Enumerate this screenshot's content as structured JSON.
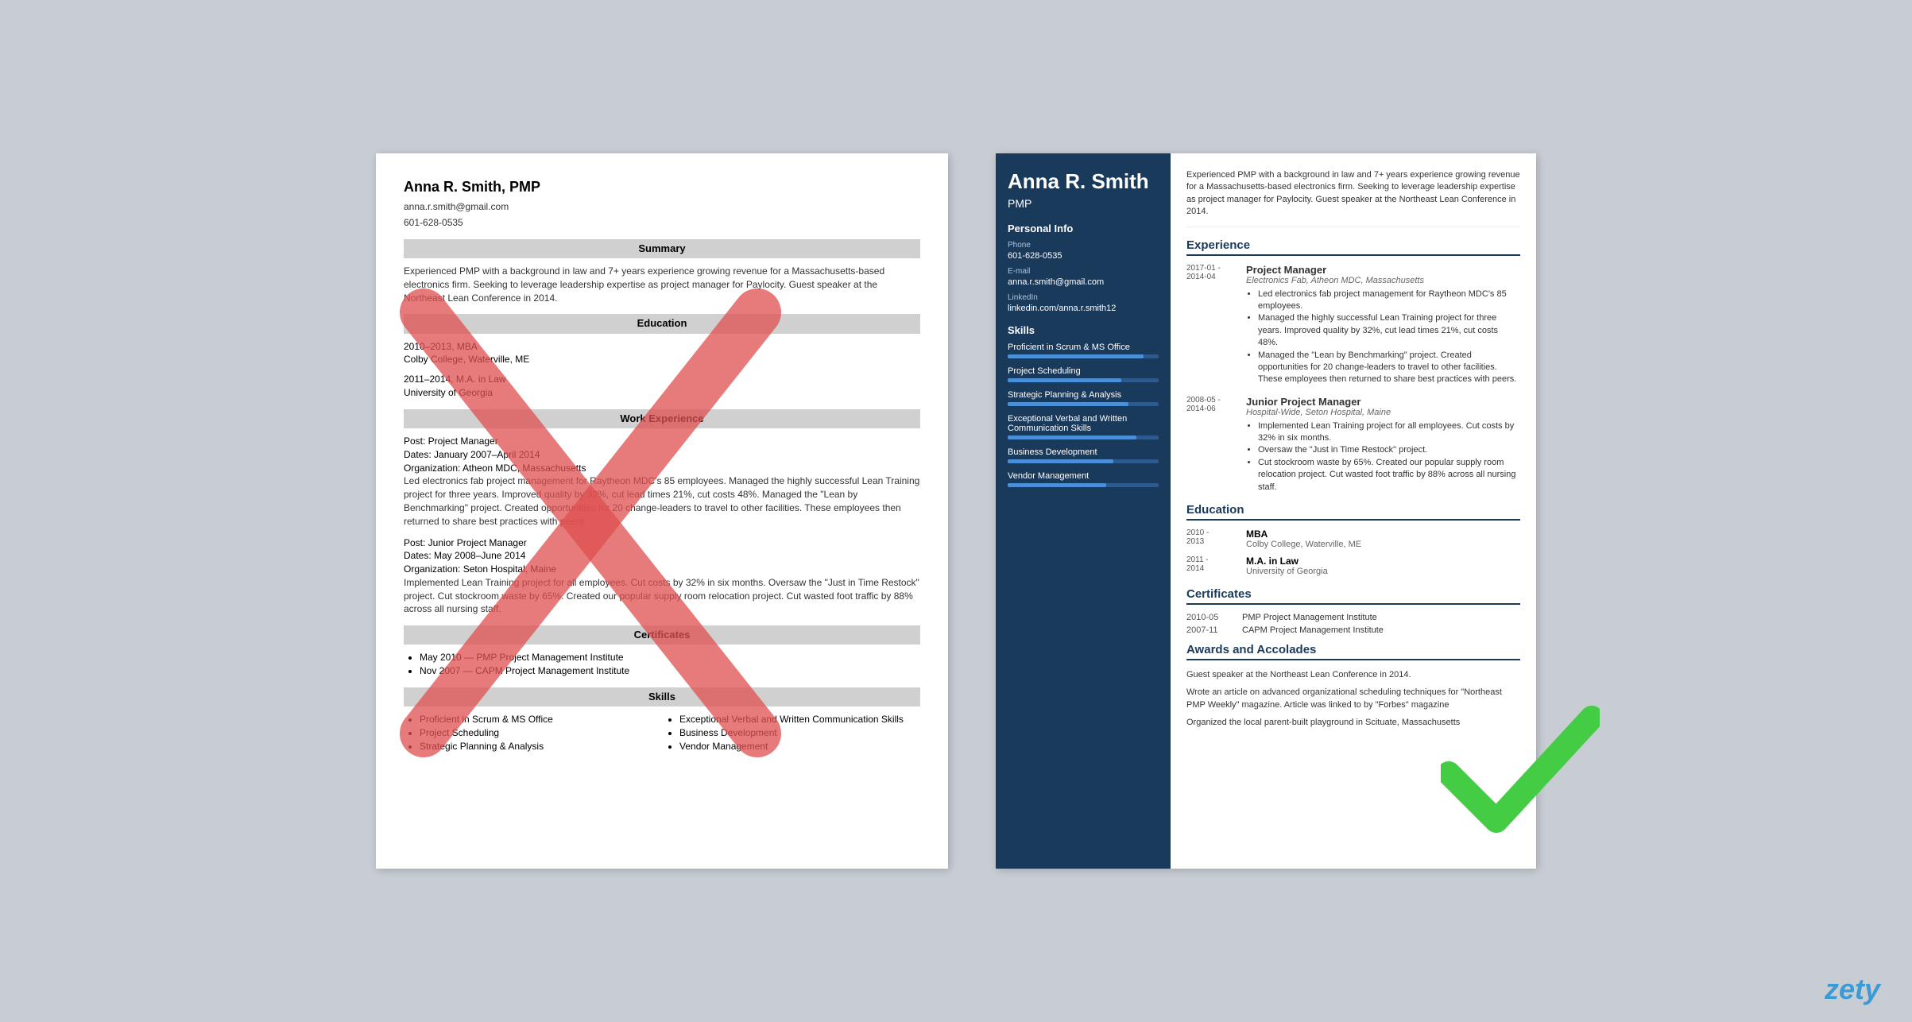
{
  "page": {
    "background_color": "#c8cdd4"
  },
  "left_resume": {
    "name": "Anna R. Smith, PMP",
    "email": "anna.r.smith@gmail.com",
    "phone": "601-628-0535",
    "sections": {
      "summary": {
        "header": "Summary",
        "content": "Experienced PMP with a background in law and 7+ years experience growing revenue for a Massachusetts-based electronics firm. Seeking to leverage leadership expertise as project manager for Paylocity. Guest speaker at the Northeast Lean Conference in 2014."
      },
      "education": {
        "header": "Education",
        "entries": [
          {
            "dates": "2010–2013, MBA",
            "school": "Colby College, Waterville, ME"
          },
          {
            "dates": "2011–2014, M.A. in Law",
            "school": "University of Georgia"
          }
        ]
      },
      "work_experience": {
        "header": "Work Experience",
        "entries": [
          {
            "post": "Post: Project Manager",
            "dates": "Dates: January 2007–April 2014",
            "org": "Organization: Atheon MDC, Massachusetts",
            "desc": "Led electronics fab project management for Raytheon MDC's 85 employees. Managed the highly successful Lean Training project for three years. Improved quality by 32%, cut lead times 21%, cut costs 48%. Managed the \"Lean by Benchmarking\" project. Created opportunities for 20 change-leaders to travel to other facilities. These employees then returned to share best practices with peers."
          },
          {
            "post": "Post: Junior Project Manager",
            "dates": "Dates: May 2008–June 2014",
            "org": "Organization: Seton Hospital, Maine",
            "desc": "Implemented Lean Training project for all employees. Cut costs by 32% in six months. Oversaw the \"Just in Time Restock\" project. Cut stockroom waste by 65%. Created our popular supply room relocation project. Cut wasted foot traffic by 88% across all nursing staff."
          }
        ]
      },
      "certificates": {
        "header": "Certificates",
        "items": [
          "May 2010 — PMP Project Management Institute",
          "Nov 2007 — CAPM Project Management Institute"
        ]
      },
      "skills": {
        "header": "Skills",
        "col1": [
          "Proficient in Scrum & MS Office",
          "Project Scheduling",
          "Strategic Planning & Analysis"
        ],
        "col2": [
          "Exceptional Verbal and Written Communication Skills",
          "Business Development",
          "Vendor Management"
        ]
      }
    }
  },
  "right_resume": {
    "sidebar": {
      "name": "Anna R. Smith",
      "title": "PMP",
      "personal_info": {
        "section_title": "Personal Info",
        "phone_label": "Phone",
        "phone": "601-628-0535",
        "email_label": "E-mail",
        "email": "anna.r.smith@gmail.com",
        "linkedin_label": "LinkedIn",
        "linkedin": "linkedin.com/anna.r.smith12"
      },
      "skills": {
        "section_title": "Skills",
        "items": [
          {
            "name": "Proficient in Scrum & MS Office",
            "level": 90
          },
          {
            "name": "Project Scheduling",
            "level": 75
          },
          {
            "name": "Strategic Planning & Analysis",
            "level": 80
          },
          {
            "name": "Exceptional Verbal and Written Communication Skills",
            "level": 85
          },
          {
            "name": "Business Development",
            "level": 70
          },
          {
            "name": "Vendor Management",
            "level": 65
          }
        ]
      }
    },
    "main": {
      "summary": "Experienced PMP with a background in law and 7+ years experience growing revenue for a Massachusetts-based electronics firm. Seeking to leverage leadership expertise as project manager for Paylocity. Guest speaker at the Northeast Lean Conference in 2014.",
      "experience": {
        "section_title": "Experience",
        "entries": [
          {
            "dates": "2017-01 -\n2014-04",
            "title": "Project Manager",
            "company": "Electronics Fab, Atheon MDC, Massachusetts",
            "bullets": [
              "Led electronics fab project management for Raytheon MDC's 85 employees.",
              "Managed the highly successful Lean Training project for three years. Improved quality by 32%, cut lead times 21%, cut costs 48%.",
              "Managed the \"Lean by Benchmarking\" project. Created opportunities for 20 change-leaders to travel to other facilities. These employees then returned to share best practices with peers."
            ]
          },
          {
            "dates": "2008-05 -\n2014-06",
            "title": "Junior Project Manager",
            "company": "Hospital-Wide, Seton Hospital, Maine",
            "bullets": [
              "Implemented Lean Training project for all employees. Cut costs by 32% in six months.",
              "Oversaw the \"Just in Time Restock\" project.",
              "Cut stockroom waste by 65%. Created our popular supply room relocation project. Cut wasted foot traffic by 88% across all nursing staff."
            ]
          }
        ]
      },
      "education": {
        "section_title": "Education",
        "entries": [
          {
            "dates": "2010 -\n2013",
            "degree": "MBA",
            "school": "Colby College, Waterville, ME"
          },
          {
            "dates": "2011 -\n2014",
            "degree": "M.A. in Law",
            "school": "University of Georgia"
          }
        ]
      },
      "certificates": {
        "section_title": "Certificates",
        "entries": [
          {
            "date": "2010-05",
            "name": "PMP Project Management Institute"
          },
          {
            "date": "2007-11",
            "name": "CAPM Project Management Institute"
          }
        ]
      },
      "awards": {
        "section_title": "Awards and Accolades",
        "items": [
          "Guest speaker at the Northeast Lean Conference in 2014.",
          "Wrote an article on advanced organizational scheduling techniques for \"Northeast PMP Weekly\" magazine. Article was linked to by \"Forbes\" magazine",
          "Organized the local parent-built playground in Scituate, Massachusetts"
        ]
      }
    }
  },
  "watermark": {
    "text": "zety"
  }
}
